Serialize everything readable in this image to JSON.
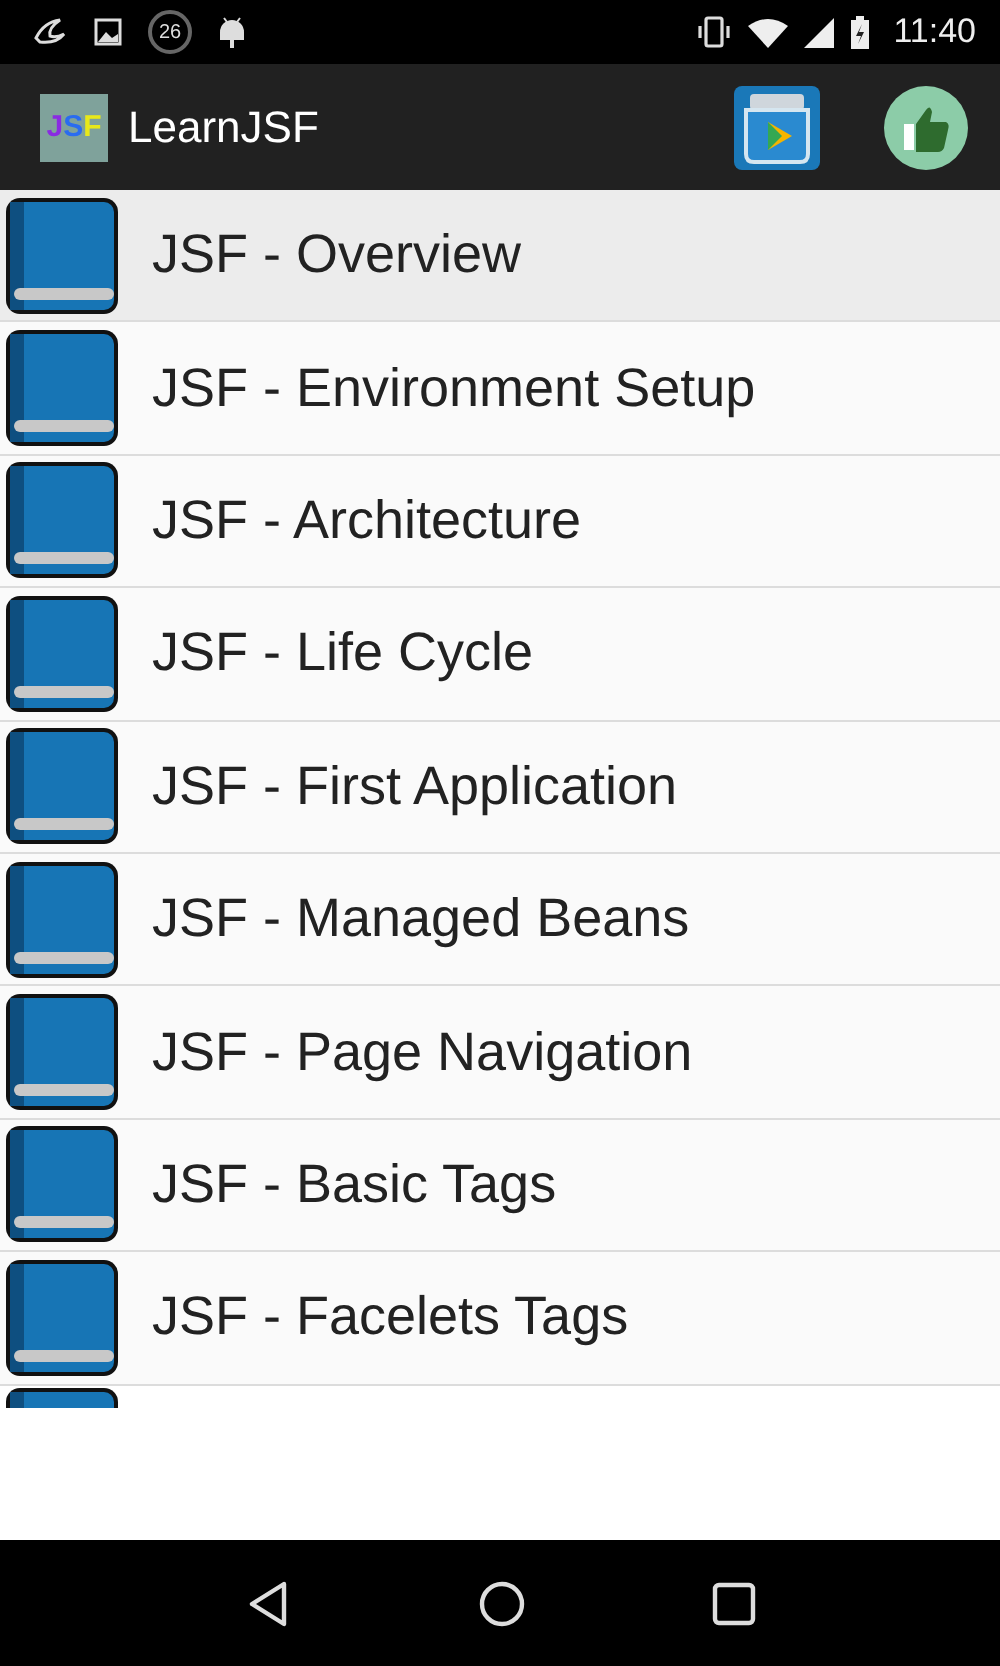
{
  "status_bar": {
    "notification_count": "26",
    "time": "11:40"
  },
  "app_bar": {
    "logo_letters": [
      {
        "text": "J",
        "color": "#8a2be2"
      },
      {
        "text": "S",
        "color": "#2a6cf0"
      },
      {
        "text": "F",
        "color": "#e8e81a"
      }
    ],
    "title": "LearnJSF"
  },
  "topics": [
    {
      "title": "JSF - Overview",
      "selected": true
    },
    {
      "title": "JSF - Environment Setup",
      "selected": false
    },
    {
      "title": "JSF - Architecture",
      "selected": false
    },
    {
      "title": "JSF - Life Cycle",
      "selected": false
    },
    {
      "title": "JSF - First Application",
      "selected": false
    },
    {
      "title": "JSF - Managed Beans",
      "selected": false
    },
    {
      "title": "JSF - Page Navigation",
      "selected": false
    },
    {
      "title": "JSF - Basic Tags",
      "selected": false
    },
    {
      "title": "JSF - Facelets Tags",
      "selected": false
    }
  ],
  "more_below": true
}
